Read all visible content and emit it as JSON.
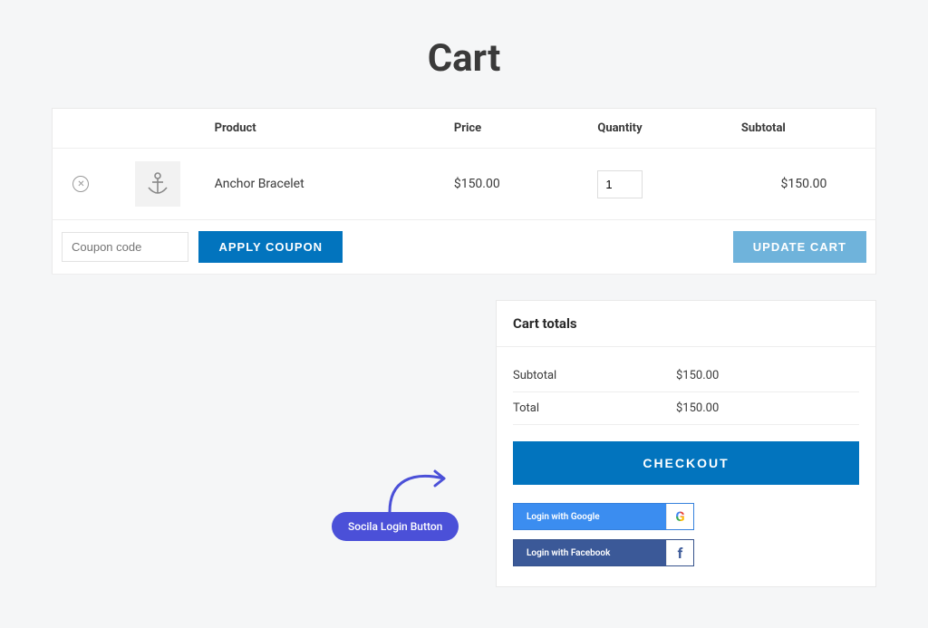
{
  "page": {
    "title": "Cart"
  },
  "table": {
    "headers": {
      "product": "Product",
      "price": "Price",
      "quantity": "Quantity",
      "subtotal": "Subtotal"
    },
    "items": [
      {
        "name": "Anchor Bracelet",
        "price": "$150.00",
        "qty": "1",
        "subtotal": "$150.00"
      }
    ]
  },
  "coupon": {
    "placeholder": "Coupon code",
    "apply_label": "APPLY COUPON"
  },
  "update_cart_label": "UPDATE CART",
  "totals": {
    "heading": "Cart totals",
    "subtotal_label": "Subtotal",
    "subtotal_value": "$150.00",
    "total_label": "Total",
    "total_value": "$150.00",
    "checkout_label": "CHECKOUT"
  },
  "social": {
    "google_label": "Login with Google",
    "facebook_label": "Login with Facebook"
  },
  "annotation": {
    "label": "Socila Login Button"
  }
}
